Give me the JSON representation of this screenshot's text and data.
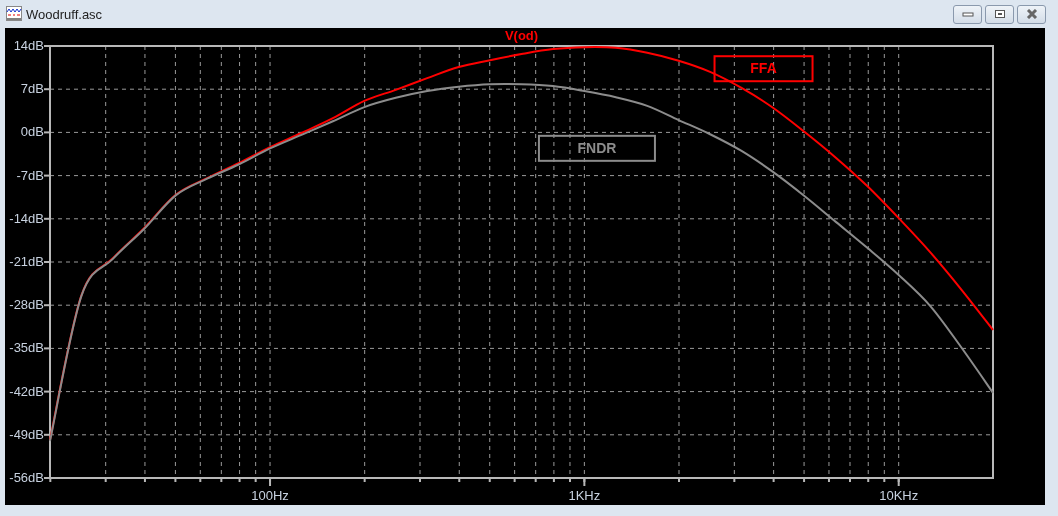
{
  "window": {
    "title": "Woodruff.asc"
  },
  "plot": {
    "chart_data": {
      "type": "line",
      "title": "V(od)",
      "grid": true,
      "categories": [
        null,
        null,
        null,
        null,
        null,
        null,
        null,
        "100Hz",
        null,
        null,
        null,
        null,
        null,
        null,
        null,
        null,
        null,
        "1KHz",
        null,
        null,
        null,
        null,
        null,
        null,
        null,
        null,
        null,
        "10KHz",
        null,
        null,
        null
      ],
      "series": [
        {
          "name": "FFA",
          "color": "#ff0000",
          "values": [
            -49.8,
            -26.4,
            -20.4,
            -15.5,
            -10.1,
            -7.4,
            -5.0,
            -2.4,
            -0.1,
            2.3,
            5.1,
            6.9,
            8.8,
            10.6,
            11.7,
            12.7,
            13.5,
            13.8,
            13.7,
            12.9,
            11.6,
            9.8,
            7.2,
            4.0,
            0.1,
            -4.1,
            -8.7,
            -13.9,
            -19.4,
            -25.5,
            -32.0
          ]
        },
        {
          "name": "FNDR",
          "color": "#8c8c8c",
          "values": [
            -50.0,
            -26.5,
            -20.5,
            -15.6,
            -10.2,
            -7.5,
            -5.2,
            -2.6,
            -0.4,
            1.8,
            4.1,
            5.6,
            6.7,
            7.4,
            7.8,
            7.8,
            7.5,
            6.7,
            5.7,
            4.3,
            2.0,
            -0.3,
            -3.0,
            -6.4,
            -10.3,
            -14.5,
            -18.7,
            -23.1,
            -28.1,
            -34.9,
            -42.2
          ]
        }
      ],
      "ylim": [
        -56,
        14
      ],
      "yticks": [
        {
          "value": 14,
          "label": "14dB"
        },
        {
          "value": 7,
          "label": "7dB"
        },
        {
          "value": 0,
          "label": "0dB"
        },
        {
          "value": -7,
          "label": "-7dB"
        },
        {
          "value": -14,
          "label": "-14dB"
        },
        {
          "value": -21,
          "label": "-21dB"
        },
        {
          "value": -28,
          "label": "-28dB"
        },
        {
          "value": -35,
          "label": "-35dB"
        },
        {
          "value": -42,
          "label": "-42dB"
        },
        {
          "value": -49,
          "label": "-49dB"
        },
        {
          "value": -56,
          "label": "-56dB"
        }
      ]
    }
  }
}
